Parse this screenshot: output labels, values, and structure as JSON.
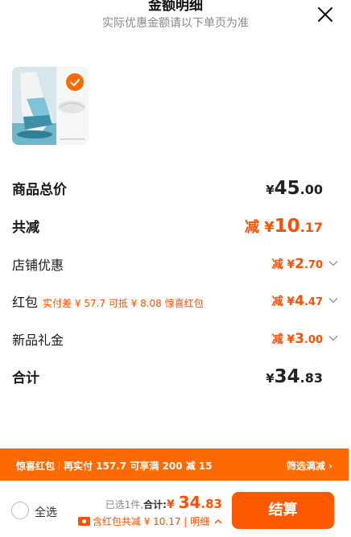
{
  "header": {
    "title": "金额明细",
    "subtitle": "实际优惠金额请以下单页为准",
    "close_icon": "close-icon"
  },
  "product": {
    "image_icon": "product-thumbnail",
    "selected": true
  },
  "rows": {
    "subtotal": {
      "label": "商品总价",
      "currency": "¥",
      "int": "45",
      "dec": ".00"
    },
    "total_discount": {
      "label": "共减",
      "prefix": "减 ¥",
      "int": "10",
      "dec": ".17"
    },
    "store_coupon": {
      "label": "店铺优惠",
      "prefix": "减 ¥",
      "int": "2",
      "dec": ".70"
    },
    "red_packet": {
      "label": "红包",
      "note": "实付差 ¥ 57.7 可抵 ¥ 8.08 惊喜红包",
      "prefix": "减 ¥",
      "int": "4",
      "dec": ".47"
    },
    "new_gift": {
      "label": "新品礼金",
      "prefix": "减 ¥",
      "int": "3",
      "dec": ".00"
    },
    "total": {
      "label": "合计",
      "currency": "¥",
      "int": "34",
      "dec": ".83"
    }
  },
  "banner": {
    "tag": "惊喜红包",
    "text": "再实付 157.7 可享满 200 减 15",
    "link": "筛选满减"
  },
  "footer": {
    "select_all": "全选",
    "selected_count": "已选1件,",
    "total_label": "合计:",
    "currency": "¥ ",
    "int": "34",
    "dec": ".83",
    "detail_text": "含红包共减 ¥ 10.17 | 明细",
    "pay_button": "结算"
  },
  "colors": {
    "accent": "#ff5000",
    "banner_bg": "#ff6a00",
    "pay_button_bg": "#ff5a00"
  }
}
